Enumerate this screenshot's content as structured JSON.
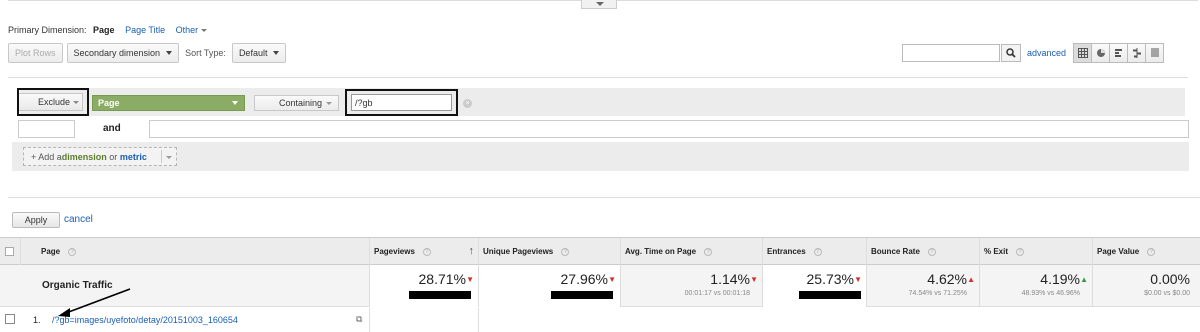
{
  "primary_dimension": {
    "label": "Primary Dimension:",
    "active": "Page",
    "links": [
      "Page Title",
      "Other"
    ]
  },
  "toolbar": {
    "plot_rows": "Plot Rows",
    "secondary_dimension": "Secondary dimension",
    "sort_type_label": "Sort Type:",
    "sort_type_value": "Default",
    "search_value": "",
    "search_icon": "magnifier-icon",
    "advanced": "advanced",
    "views": [
      "table-view-icon",
      "pie-view-icon",
      "performance-view-icon",
      "comparison-view-icon",
      "pivot-view-icon"
    ]
  },
  "filter": {
    "mode": "Exclude",
    "dimension": "Page",
    "match": "Containing",
    "value": "/?gb",
    "and_label": "and",
    "add_prefix": "+ Add a ",
    "add_dimension": "dimension",
    "add_or": " or ",
    "add_metric": "metric",
    "apply": "Apply",
    "cancel": "cancel"
  },
  "table": {
    "headers": {
      "page": "Page",
      "pageviews": "Pageviews",
      "unique_pageviews": "Unique Pageviews",
      "avg_time": "Avg. Time on Page",
      "entrances": "Entrances",
      "bounce_rate": "Bounce Rate",
      "exit": "% Exit",
      "page_value": "Page Value"
    },
    "summary": {
      "label": "Organic Traffic",
      "pageviews": "28.71%",
      "unique_pageviews": "27.96%",
      "avg_time": "1.14%",
      "avg_time_sub": "00:01:17 vs 00:01:18",
      "entrances": "25.73%",
      "bounce_rate": "4.62%",
      "bounce_rate_sub": "74.54% vs 71.25%",
      "exit": "4.19%",
      "exit_sub": "48.93% vs 46.96%",
      "page_value": "0.00%",
      "page_value_sub": "$0.00 vs $0.00"
    },
    "rows": [
      {
        "num": "1.",
        "page": "/?gb=images/uyefoto/detay/20151003_160654"
      }
    ]
  },
  "colors": {
    "link": "#1a5fb4",
    "page_dim_bg": "#8aac64",
    "down_red": "#d32f2f",
    "up_green": "#3a9a3a"
  }
}
